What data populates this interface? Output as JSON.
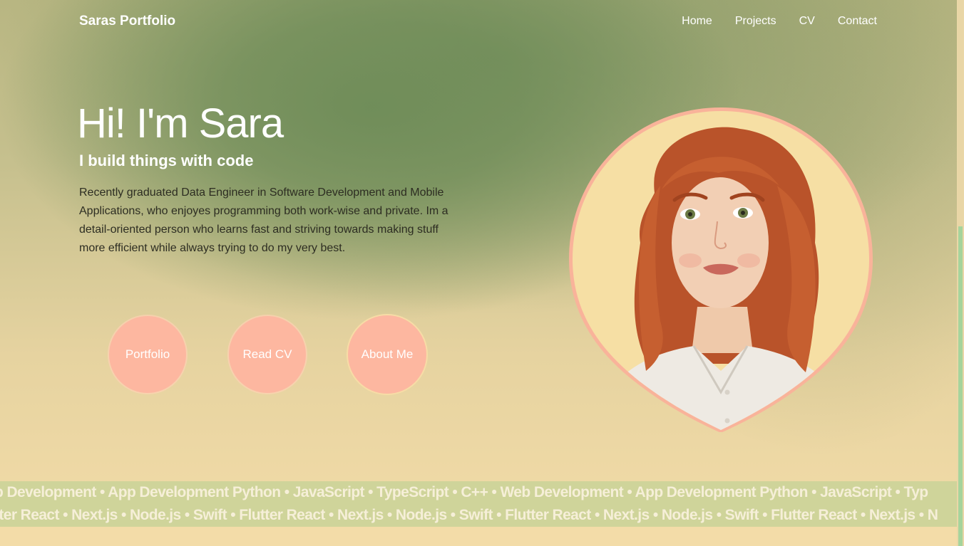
{
  "nav": {
    "brand": "Saras Portfolio",
    "links": [
      "Home",
      "Projects",
      "CV",
      "Contact"
    ]
  },
  "hero": {
    "title": "Hi! I'm Sara",
    "subtitle": "I build things with code",
    "description": "Recently graduated Data Engineer in Software Development and Mobile Applications, who enjoyes programming both work-wise and private. Im a detail-oriented person who learns fast and striving towards making stuff more efficient while always trying to do my very best."
  },
  "buttons": {
    "portfolio": "Portfolio",
    "cv": "Read CV",
    "about": "About Me"
  },
  "marquee": {
    "row1": "b Development • App Development Python • JavaScript • TypeScript • C++ • Web Development • App Development Python • JavaScript • Typ",
    "row2": "tter React • Next.js • Node.js • Swift • Flutter React • Next.js • Node.js • Swift • Flutter React • Next.js • Node.js • Swift • Flutter React • Next.js • N"
  },
  "colors": {
    "button": "#fdb7a0",
    "portrait_ring": "#f9b39a",
    "marquee_band": "#cfd49a",
    "scrollbar_thumb": "#a6d49c"
  },
  "icons": {
    "portrait": "portrait-illustration"
  }
}
